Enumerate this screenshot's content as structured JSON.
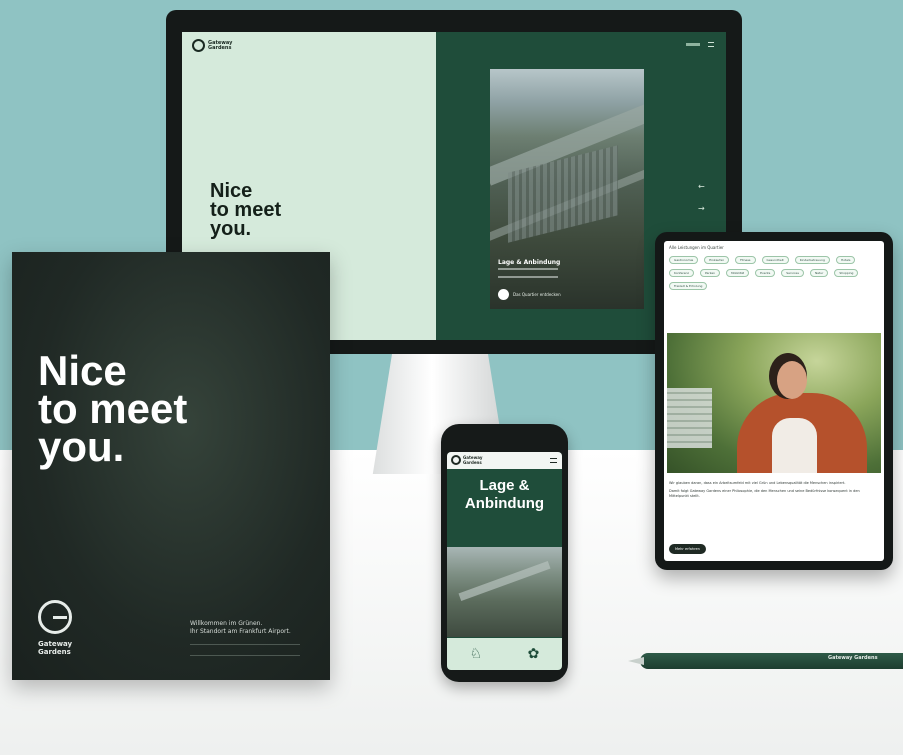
{
  "imac": {
    "logo_text": "Gateway Gardens",
    "headline_lines": [
      "Nice",
      "to meet",
      "you."
    ],
    "photo_title": "Lage & Anbindung",
    "play_label": "Das Quartier entdecken",
    "arrow_up": "←",
    "arrow_down": "→"
  },
  "brochure": {
    "headline_lines": [
      "Nice",
      "to meet",
      "you."
    ],
    "logo_text": "Gateway Gardens",
    "tagline_lines": [
      "Willkommen im Grünen.",
      "Ihr Standort am Frankfurt Airport."
    ]
  },
  "phone": {
    "logo_text": "Gateway Gardens",
    "heading_lines": [
      "Lage &",
      "Anbindung"
    ],
    "icon_left": "♘",
    "icon_right": "✿"
  },
  "tablet": {
    "top_label": "Alle Leistungen im Quartier",
    "chips": [
      "Gastronomie",
      "Einkaufen",
      "Fitness",
      "Gesundheit",
      "Kinderbetreuung",
      "Hotels",
      "Konferenz",
      "Parken",
      "Mobilität",
      "Events",
      "Services",
      "Natur",
      "Shopping",
      "Freizeit & Erholung"
    ],
    "paragraphs": [
      "Wir glauben daran, dass ein Arbeitsumfeld mit viel Grün und Lebensqualität die Menschen inspiriert.",
      "Damit folgt Gateway Gardens einer Philosophie, die den Menschen und seine Bedürfnisse konsequent in den Mittelpunkt stellt."
    ],
    "button_label": "Mehr erfahren"
  },
  "pen": {
    "brand_text": "Gateway Gardens"
  },
  "colors": {
    "background_top": "#8fc3c3",
    "brand_dark_green": "#1f4d3a",
    "mint": "#d5eadb",
    "brochure": "#202925"
  }
}
